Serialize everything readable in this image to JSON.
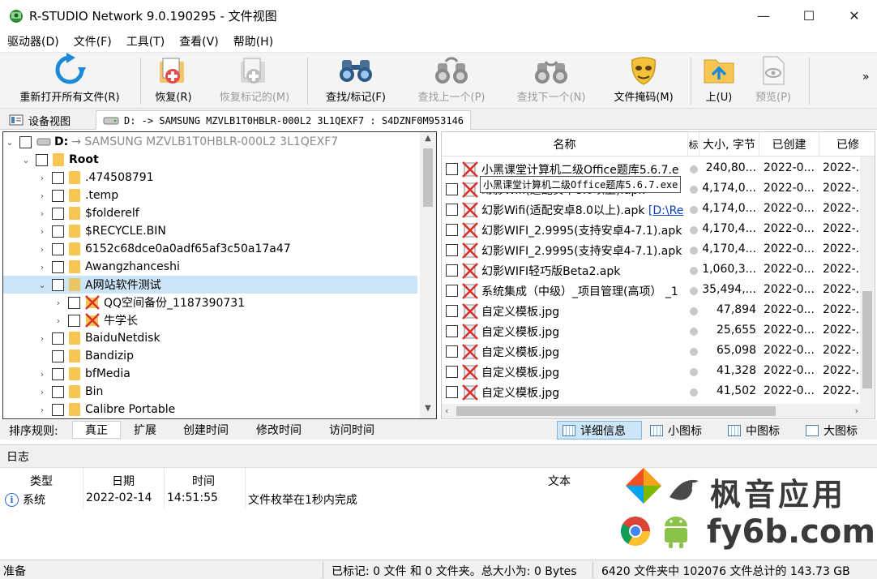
{
  "window": {
    "title": "R-STUDIO Network 9.0.190295 - 文件视图",
    "minimize": "—",
    "maximize": "☐",
    "close": "✕"
  },
  "menu": [
    "驱动器(D)",
    "文件(F)",
    "工具(T)",
    "查看(V)",
    "帮助(H)"
  ],
  "toolbar": {
    "reopen": "重新打开所有文件(R)",
    "recover": "恢复(R)",
    "recover_marked": "恢复标记的(M)",
    "find_mark": "查找/标记(F)",
    "find_prev": "查找上一个(P)",
    "find_next": "查找下一个(N)",
    "file_mask": "文件掩码(M)",
    "up": "上(U)",
    "preview": "预览(P)",
    "overflow": "»"
  },
  "tabs": {
    "device_view": "设备视图",
    "drive_tab": "D: -> SAMSUNG MZVLB1T0HBLR-000L2 3L1QEXF7 : S4DZNF0M953146"
  },
  "tree": {
    "drive": "D:",
    "drive_desc": "→ SAMSUNG MZVLB1T0HBLR-000L2 3L1QEXF7",
    "root": "Root",
    "items": [
      ".474508791",
      ".temp",
      "$folderelf",
      "$RECYCLE.BIN",
      "6152c68dce0a0adf65af3c50a17a47",
      "Awangzhanceshi",
      "A网站软件测试",
      "QQ空间备份_1187390731",
      "牛学长",
      "BaiduNetdisk",
      "Bandizip",
      "bfMedia",
      "Bin",
      "Calibre Portable"
    ]
  },
  "filelist": {
    "headers": {
      "name": "名称",
      "flag": "标",
      "size": "大小, 字节",
      "created": "已创建",
      "modified": "已修"
    },
    "tooltip": "小黑课堂计算机二级Office题库5.6.7.exe",
    "rows": [
      {
        "name": "小黑课堂计算机二级Office题库5.6.7.e",
        "size": "240,80...",
        "created": "2022-0...",
        "modified": "2022-..."
      },
      {
        "name": "幻影Wifi(适配安卓8.0以上).apk",
        "size": "4,174,0...",
        "created": "2022-0...",
        "modified": "2022-..."
      },
      {
        "name": "幻影Wifi(适配安卓8.0以上).apk",
        "link": "[D:\\Re",
        "size": "4,174,0...",
        "created": "2022-0...",
        "modified": "2022-..."
      },
      {
        "name": "幻影WIFI_2.9995(支持安卓4-7.1).apk",
        "size": "4,170,4...",
        "created": "2022-0...",
        "modified": "2022-..."
      },
      {
        "name": "幻影WIFI_2.9995(支持安卓4-7.1).apk",
        "size": "4,170,4...",
        "created": "2022-0...",
        "modified": "2022-..."
      },
      {
        "name": "幻影WIFI轻巧版Beta2.apk",
        "size": "1,060,3...",
        "created": "2022-0...",
        "modified": "2022-..."
      },
      {
        "name": "系统集成（中级）_项目管理(高项） _1",
        "size": "35,494,...",
        "created": "2022-0...",
        "modified": "2022-..."
      },
      {
        "name": "自定义模板.jpg",
        "size": "47,894",
        "created": "2022-0...",
        "modified": "2022-..."
      },
      {
        "name": "自定义模板.jpg",
        "size": "25,655",
        "created": "2022-0...",
        "modified": "2022-..."
      },
      {
        "name": "自定义模板.jpg",
        "size": "65,098",
        "created": "2022-0...",
        "modified": "2022-..."
      },
      {
        "name": "自定义模板.jpg",
        "size": "41,328",
        "created": "2022-0...",
        "modified": "2022-..."
      },
      {
        "name": "自定义模板.jpg",
        "size": "41,502",
        "created": "2022-0...",
        "modified": "2022-..."
      }
    ]
  },
  "sortbar": {
    "label": "排序规则:",
    "options": [
      "真正",
      "扩展",
      "创建时间",
      "修改时间",
      "访问时间"
    ],
    "views": [
      "详细信息",
      "小图标",
      "中图标",
      "大图标"
    ]
  },
  "log": {
    "title": "日志",
    "headers": {
      "type": "类型",
      "date": "日期",
      "time": "时间",
      "text": "文本"
    },
    "row": {
      "type": "系统",
      "date": "2022-02-14",
      "time": "14:51:55",
      "text": "文件枚举在1秒内完成"
    }
  },
  "watermark": {
    "line1": "枫音应用",
    "line2": "fy6b.com"
  },
  "status": {
    "ready": "准备",
    "marked": "已标记:  0 文件 和 0 文件夹。总大小为: 0 Bytes",
    "totals": "6420 文件夹中 102076 文件总计的 143.73 GB"
  },
  "colors": {
    "folder": "#f7c652",
    "selection": "#cce4f7",
    "active_view": "#cde6f7",
    "link": "#0b3fbf",
    "deleted_mark": "#d9302c"
  }
}
